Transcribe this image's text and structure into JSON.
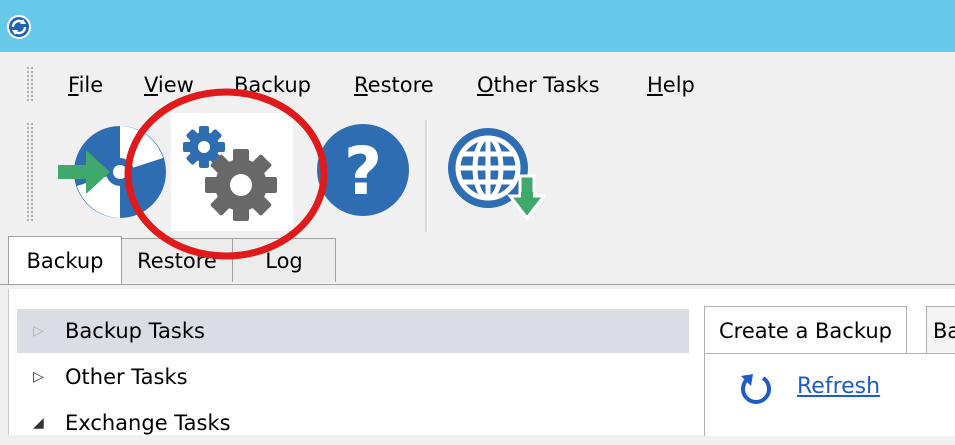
{
  "menu": {
    "items": [
      {
        "accel": "F",
        "rest": "ile"
      },
      {
        "accel": "V",
        "rest": "iew"
      },
      {
        "accel": "B",
        "rest": "ackup"
      },
      {
        "accel": "R",
        "rest": "estore"
      },
      {
        "accel": "O",
        "rest": "ther Tasks"
      },
      {
        "accel": "H",
        "rest": "elp"
      }
    ]
  },
  "tabs": [
    "Backup",
    "Restore",
    "Log"
  ],
  "tree": {
    "items": [
      {
        "label": "Backup Tasks",
        "glyph": "▷"
      },
      {
        "label": "Other Tasks",
        "glyph": "▷"
      },
      {
        "label": "Exchange Tasks",
        "glyph": "◢"
      }
    ]
  },
  "right_panel": {
    "tabs": [
      "Create a Backup",
      "Ba"
    ],
    "refresh_label": "Refresh"
  },
  "colors": {
    "titlebar": "#67c9e9",
    "annotation": "#e01a1a",
    "link": "#1e5bc6",
    "icon_blue": "#2f6db3",
    "gear_gray": "#686868",
    "arrow_green": "#3fa86b"
  }
}
